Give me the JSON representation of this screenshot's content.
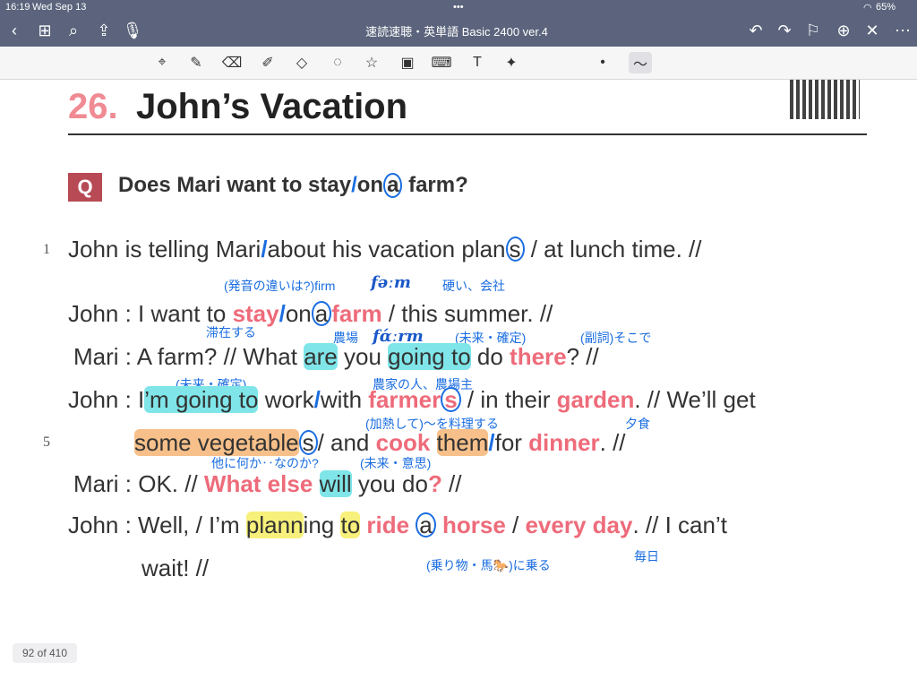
{
  "status": {
    "time": "16:19",
    "date": "Wed Sep 13",
    "battery": "65%"
  },
  "nav": {
    "title": "速読速聴・英単語 Basic 2400 ver.4"
  },
  "heading": {
    "number": "26.",
    "title": "John’s Vacation"
  },
  "question": {
    "label": "Q",
    "text_a": "Does Mari want to stay",
    "slash": "/",
    "text_b": "on",
    "circled": "a",
    "text_c": " farm?"
  },
  "line_numbers": {
    "l1": "1",
    "l5": "5"
  },
  "sentence1": {
    "a": "John is telling Mari",
    "b": "about his vacation plan",
    "s": "s",
    "c": " / at lunch time. //"
  },
  "notes": {
    "pron": "(発音の違いは?)firm",
    "ferm": "fəːm",
    "hard": "硬い、会社",
    "stay": "滞在する",
    "farm_jp": "農場",
    "farm_pron": "fɑ́ːrm",
    "future1": "(未来・確定)",
    "adv": "(副詞)そこで",
    "future2": "(未来・確定)",
    "farmer": "農家の人、農場主",
    "cook_jp": "(加熱して)〜を料理する",
    "dinner_jp": "夕食",
    "else_jp": "他に何か‥なのか?",
    "will_jp": "(未来・意思)",
    "ride_jp": "(乗り物・馬🐎)に乗る",
    "everyday_jp": "毎日"
  },
  "line2": {
    "speaker": "John :",
    "a": " I want to ",
    "stay": "stay",
    "b": "on",
    "circ": "a",
    "farm": "farm",
    "c": " / this summer. //"
  },
  "line3": {
    "speaker": "Mari :",
    "a": " A farm? // What ",
    "are": "are",
    "b": " you ",
    "going": "going to",
    "c": " do ",
    "there": "there",
    "d": "? //"
  },
  "line4": {
    "speaker": "John :",
    "a": " I",
    "im": "’m going to",
    "b": " work",
    "c": "with ",
    "farmer": "farmer",
    "s": "s",
    "d": " / in their ",
    "garden": "garden",
    "e": ". // We’ll get"
  },
  "line5": {
    "veg": "some vegetable",
    "s": "s",
    "a": "/ and ",
    "cook": "cook",
    "them": "them",
    "b": "for ",
    "dinner": "dinner",
    "c": ". //"
  },
  "line6": {
    "speaker": "Mari :",
    "a": " OK. // ",
    "what": "What else",
    "will": "will",
    "b": " you do",
    "q": "?",
    "c": " //"
  },
  "line7": {
    "speaker": "John :",
    "a": " Well, / I’m ",
    "plann": "plann",
    "ing": "ing ",
    "to": "to",
    "ride": " ride ",
    "circ": "a",
    "horse": " horse",
    "b": " / ",
    "every": "every day",
    "c": ". // I can’t"
  },
  "line8": {
    "a": "wait! //"
  },
  "pager": {
    "text": "92 of 410"
  }
}
